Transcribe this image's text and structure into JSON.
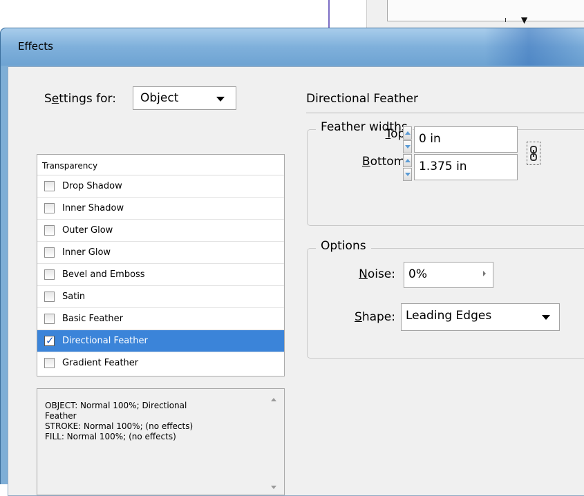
{
  "dialog": {
    "title": "Effects"
  },
  "settings": {
    "label_prefix": "S",
    "label_mnemonic": "e",
    "label_suffix": "ttings for:",
    "value": "Object"
  },
  "effects": {
    "header": "Transparency",
    "items": [
      {
        "label": "Drop Shadow",
        "checked": false
      },
      {
        "label": "Inner Shadow",
        "checked": false
      },
      {
        "label": "Outer Glow",
        "checked": false
      },
      {
        "label": "Inner Glow",
        "checked": false
      },
      {
        "label": "Bevel and Emboss",
        "checked": false
      },
      {
        "label": "Satin",
        "checked": false
      },
      {
        "label": "Basic Feather",
        "checked": false
      },
      {
        "label": "Directional Feather",
        "checked": true,
        "selected": true
      },
      {
        "label": "Gradient Feather",
        "checked": false
      }
    ]
  },
  "summary": {
    "lines": [
      "OBJECT: Normal 100%; Directional",
      "Feather",
      "STROKE: Normal 100%; (no effects)",
      "FILL: Normal 100%; (no effects)"
    ]
  },
  "panel": {
    "title": "Directional Feather",
    "feather_widths": {
      "title": "Feather widths",
      "top": {
        "mnemonic": "T",
        "rest": "op:",
        "value": "0 in"
      },
      "bottom": {
        "mnemonic": "B",
        "rest": "ottom:",
        "value": "1.375 in"
      }
    },
    "options": {
      "title": "Options",
      "noise": {
        "mnemonic": "N",
        "rest": "oise:",
        "value": "0%"
      },
      "shape": {
        "mnemonic": "S",
        "rest": "hape:",
        "value": "Leading Edges"
      }
    }
  },
  "colors": {
    "selection": "#3b84d9",
    "titlebar": "#7fb0db"
  }
}
